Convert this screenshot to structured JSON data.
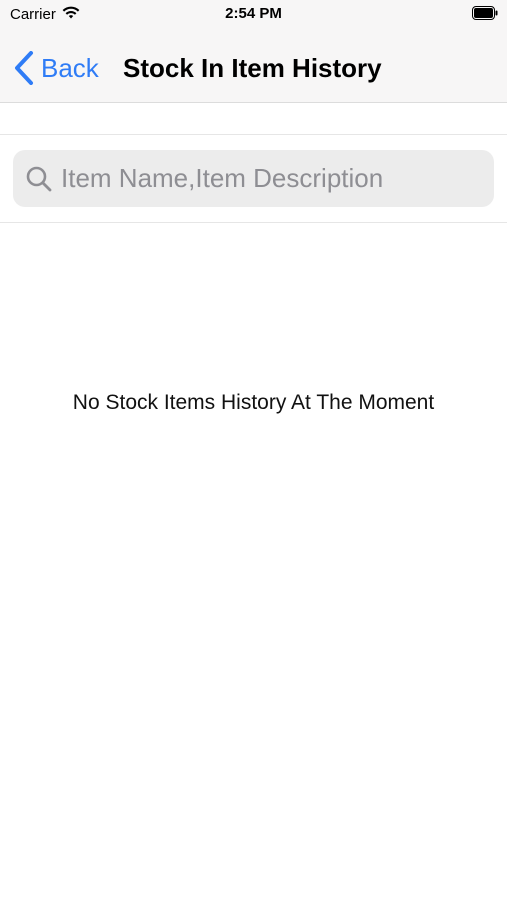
{
  "status_bar": {
    "carrier": "Carrier",
    "time": "2:54 PM"
  },
  "nav": {
    "back_label": "Back",
    "title": "Stock In Item History"
  },
  "search": {
    "placeholder": "Item Name,Item Description",
    "value": ""
  },
  "empty_state": {
    "message": "No Stock Items History At The Moment"
  },
  "colors": {
    "accent": "#2f7cf6",
    "nav_background": "#f7f6f6",
    "search_background": "#ececec"
  },
  "icons": {
    "wifi": "wifi-icon",
    "battery": "battery-icon",
    "back": "chevron-left-icon",
    "search": "search-icon"
  }
}
